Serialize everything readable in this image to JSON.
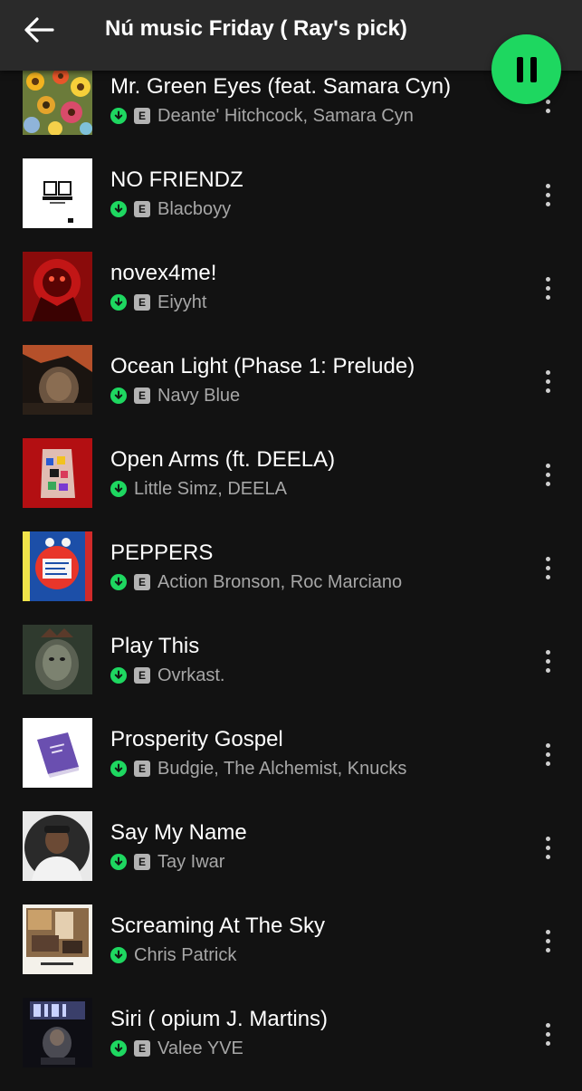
{
  "header": {
    "title": "Nú music Friday ( Ray's pick)"
  },
  "colors": {
    "accent": "#1ed760",
    "background": "#121212",
    "header": "#2a2a2a",
    "subtext": "#a7a7a7"
  },
  "tracks": [
    {
      "title": "Mr. Green Eyes (feat. Samara Cyn)",
      "artist": "Deante' Hitchcock, Samara Cyn",
      "explicit": true,
      "explicit_label": "E",
      "cover_icon": "sunflowers-art"
    },
    {
      "title": "NO FRIENDZ",
      "artist": "Blacboyy",
      "explicit": true,
      "explicit_label": "E",
      "cover_icon": "walahi-logo"
    },
    {
      "title": "novex4me!",
      "artist": "Eiyyht",
      "explicit": true,
      "explicit_label": "E",
      "cover_icon": "red-figure-art"
    },
    {
      "title": "Ocean Light (Phase 1: Prelude)",
      "artist": "Navy Blue",
      "explicit": true,
      "explicit_label": "E",
      "cover_icon": "dark-portrait-art"
    },
    {
      "title": "Open Arms (ft. DEELA)",
      "artist": "Little Simz, DEELA",
      "explicit": false,
      "explicit_label": "",
      "cover_icon": "red-bag-art"
    },
    {
      "title": "PEPPERS",
      "artist": "Action Bronson, Roc Marciano",
      "explicit": true,
      "explicit_label": "E",
      "cover_icon": "colorful-collage-art"
    },
    {
      "title": "Play This",
      "artist": "Ovrkast.",
      "explicit": true,
      "explicit_label": "E",
      "cover_icon": "crowned-portrait-art"
    },
    {
      "title": "Prosperity Gospel",
      "artist": "Budgie, The Alchemist, Knucks",
      "explicit": true,
      "explicit_label": "E",
      "cover_icon": "purple-book-art"
    },
    {
      "title": "Say My Name",
      "artist": "Tay Iwar",
      "explicit": true,
      "explicit_label": "E",
      "cover_icon": "portrait-photo-art"
    },
    {
      "title": "Screaming At The Sky",
      "artist": "Chris Patrick",
      "explicit": false,
      "explicit_label": "",
      "cover_icon": "polaroid-room-art"
    },
    {
      "title": "Siri ( opium J. Martins)",
      "artist": "Valee YVE",
      "explicit": true,
      "explicit_label": "E",
      "cover_icon": "siri-logo-art"
    }
  ]
}
